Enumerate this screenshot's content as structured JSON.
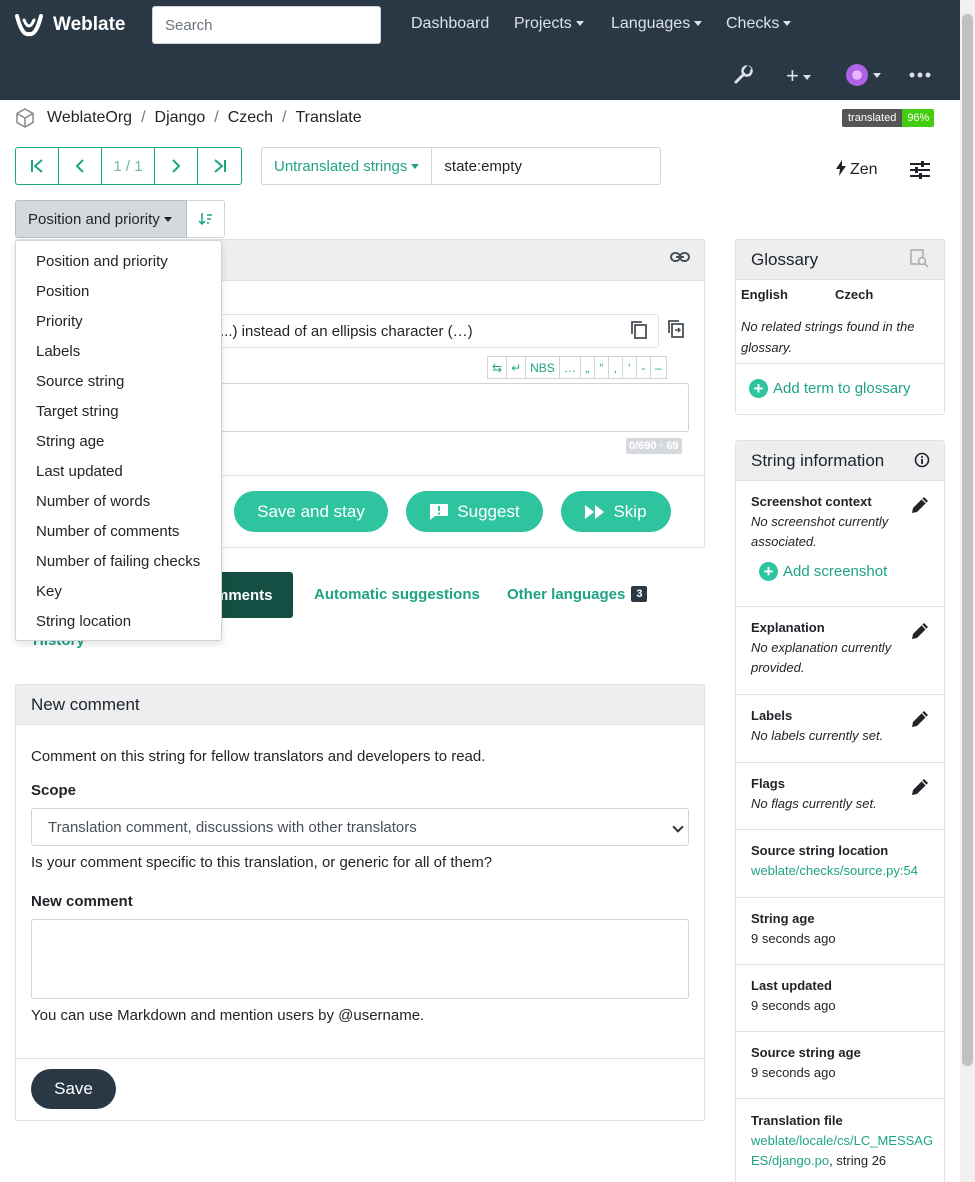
{
  "navbar": {
    "brand": "Weblate",
    "search_placeholder": "Search",
    "items": [
      "Dashboard",
      "Projects",
      "Languages",
      "Checks"
    ]
  },
  "breadcrumb": [
    "WeblateOrg",
    "Django",
    "Czech",
    "Translate"
  ],
  "badge": {
    "label": "translated",
    "value": "96%"
  },
  "pager": {
    "first": "|<",
    "prev": "<",
    "position": "1 / 1",
    "next": ">",
    "last": ">|"
  },
  "filter": {
    "label": "Untranslated strings",
    "query": "state:empty"
  },
  "zen_label": "Zen",
  "sort": {
    "label": "Position and priority"
  },
  "sort_options": [
    "Position and priority",
    "Position",
    "Priority",
    "Labels",
    "Source string",
    "Target string",
    "String age",
    "Last updated",
    "Number of words",
    "Number of comments",
    "Number of failing checks",
    "Key",
    "String location"
  ],
  "editor": {
    "source_visible": "...) instead of an ellipsis character (…)",
    "special_chars": [
      "⇆",
      "↵",
      "NBS",
      "…",
      "„",
      "“",
      "‚",
      "‘",
      "-",
      "–"
    ],
    "counter": "0/690 · 69",
    "buttons": {
      "save_stay": "Save and stay",
      "suggest": "Suggest",
      "skip": "Skip"
    }
  },
  "tabs": {
    "comments": "mments",
    "automatic": "Automatic suggestions",
    "other": "Other languages",
    "other_count": "3",
    "history": "History"
  },
  "comment": {
    "header": "New comment",
    "intro": "Comment on this string for fellow translators and developers to read.",
    "scope_label": "Scope",
    "scope_value": "Translation comment, discussions with other translators",
    "scope_help": "Is your comment specific to this translation, or generic for all of them?",
    "new_label": "New comment",
    "markdown_help": "You can use Markdown and mention users by @username.",
    "save": "Save"
  },
  "glossary": {
    "title": "Glossary",
    "col_source": "English",
    "col_target": "Czech",
    "empty": "No related strings found in the glossary.",
    "add": "Add term to glossary"
  },
  "info": {
    "title": "String information",
    "screenshot_title": "Screenshot context",
    "screenshot_value": "No screenshot currently associated.",
    "add_screenshot": "Add screenshot",
    "explanation_title": "Explanation",
    "explanation_value": "No explanation currently provided.",
    "labels_title": "Labels",
    "labels_value": "No labels currently set.",
    "flags_title": "Flags",
    "flags_value": "No flags currently set.",
    "location_title": "Source string location",
    "location_value": "weblate/checks/source.py:54",
    "age_title": "String age",
    "age_value": "9 seconds ago",
    "updated_title": "Last updated",
    "updated_value": "9 seconds ago",
    "source_age_title": "Source string age",
    "source_age_value": "9 seconds ago",
    "file_title": "Translation file",
    "file_link_1": "weblate/locale/cs/LC_MESSAG",
    "file_link_2": "ES/django.po",
    "file_suffix": ", string 26"
  },
  "colors": {
    "navbar": "#2a3744",
    "accent": "#1fa385",
    "button": "#2ec4a0"
  }
}
